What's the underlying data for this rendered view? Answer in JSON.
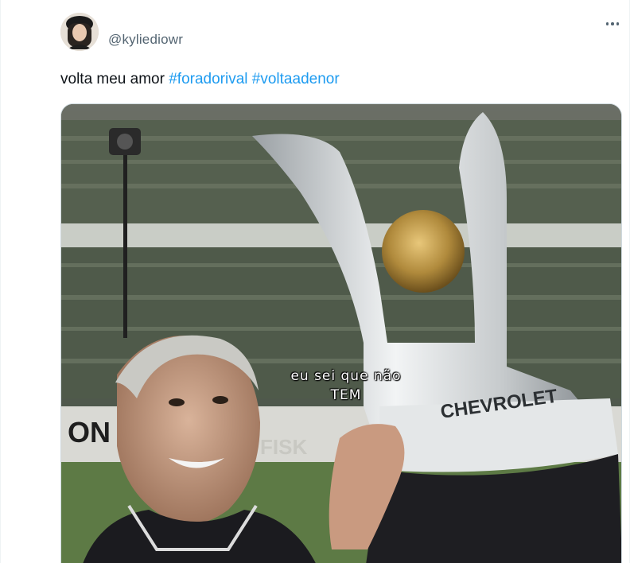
{
  "tweet": {
    "handle": "@kyliediowr",
    "text": "volta meu amor",
    "hashtags": [
      "#foradorival",
      "#voltaadenor"
    ],
    "more_icon": "more-horizontal-icon"
  },
  "media": {
    "caption_line1": "eu sei que não",
    "caption_line2": "TEM",
    "banner_text_trophy": "CHEVROLET",
    "banner_text_board": "FISK"
  }
}
